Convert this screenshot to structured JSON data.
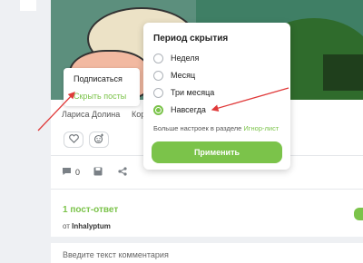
{
  "hide_menu": {
    "subscribe_label": "Подписаться",
    "hide_posts_label": "Скрыть посты"
  },
  "post": {
    "tags": [
      "Лариса Долина",
      "Коротко"
    ],
    "comments_count": "0"
  },
  "hide_period_popup": {
    "title": "Период скрытия",
    "options": [
      {
        "label": "Неделя",
        "selected": false
      },
      {
        "label": "Месяц",
        "selected": false
      },
      {
        "label": "Три месяца",
        "selected": false
      },
      {
        "label": "Навсегда",
        "selected": true
      }
    ],
    "more_settings_text": "Больше настроек в разделе",
    "more_settings_link": "Игнор-лист",
    "apply_label": "Применить"
  },
  "reply_block": {
    "title": "1 пост-ответ",
    "by_prefix": "от",
    "author": "Inhalyptum"
  },
  "comment": {
    "placeholder": "Введите текст комментария"
  },
  "colors": {
    "accent": "#7bc34a",
    "arrow": "#e03a3a"
  }
}
